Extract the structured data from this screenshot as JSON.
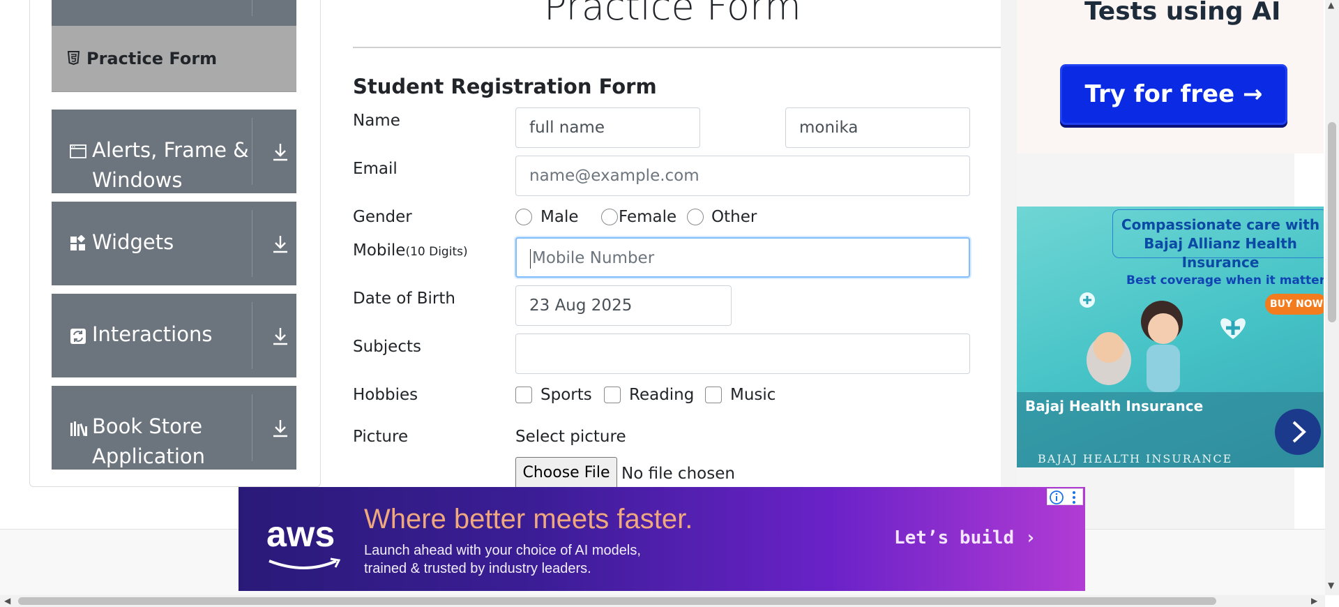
{
  "sidebar": {
    "active_item": {
      "label": "Practice Form",
      "icon": "html5-file-icon"
    },
    "groups": [
      {
        "label_line1": "Alerts, Frame &",
        "label_line2": "Windows",
        "icon": "window-icon"
      },
      {
        "label_line1": "Widgets",
        "label_line2": "",
        "icon": "widgets-icon"
      },
      {
        "label_line1": "Interactions",
        "label_line2": "",
        "icon": "interactions-icon"
      },
      {
        "label_line1": "Book Store",
        "label_line2": "Application",
        "icon": "books-icon"
      }
    ]
  },
  "form": {
    "page_title": "Practice Form",
    "heading": "Student Registration Form",
    "name_label": "Name",
    "first_name_value": "full name",
    "last_name_value": "monika",
    "email_label": "Email",
    "email_placeholder": "name@example.com",
    "gender_label": "Gender",
    "gender_options": [
      "Male",
      "Female",
      "Other"
    ],
    "mobile_label": "Mobile",
    "mobile_hint": "(10 Digits)",
    "mobile_placeholder": "Mobile Number",
    "dob_label": "Date of Birth",
    "dob_value": "23 Aug 2025",
    "subjects_label": "Subjects",
    "subjects_value": "",
    "hobbies_label": "Hobbies",
    "hobbies_options": [
      "Sports",
      "Reading",
      "Music"
    ],
    "picture_label": "Picture",
    "select_picture_label": "Select picture",
    "choose_file_label": "Choose File",
    "no_file_label": "No file chosen"
  },
  "ads": {
    "top_ad": {
      "headline": "Tests using AI",
      "button": "Try for free →",
      "button_color": "#0a2be3"
    },
    "bajaj": {
      "line1": "Compassionate care with",
      "line2": "Bajaj Allianz Health Insurance",
      "tagline": "Best coverage when it matters mos",
      "buy_now": "BUY NOW",
      "title": "Bajaj Health Insurance",
      "footer": "BAJAJ HEALTH INSURANCE"
    },
    "aws": {
      "logo": "aws",
      "headline": "Where better meets faster.",
      "sub_line1": "Launch ahead with your choice of AI models,",
      "sub_line2": "trained & trusted by industry leaders.",
      "cta": "Let’s build ›"
    }
  }
}
